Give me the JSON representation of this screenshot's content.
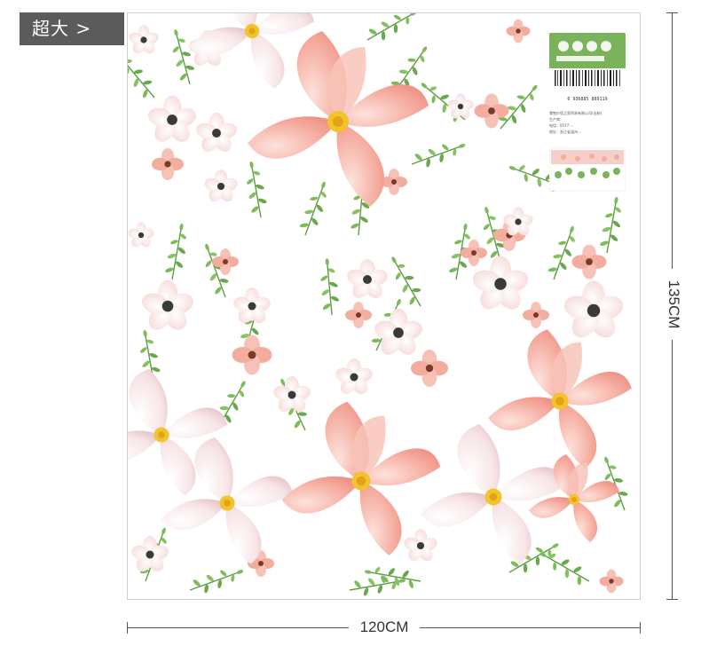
{
  "size_tag": {
    "label": "超大 >"
  },
  "dimensions": {
    "width_label": "120CM",
    "height_label": "135CM"
  },
  "package": {
    "barcode_number": "6 936885 889119",
    "info_lines": [
      "零售价您之家贸易有限公司(出制)",
      "生产商：",
      "电话：0577-...",
      "地址：浙江省温州..."
    ]
  },
  "colors": {
    "tag_bg": "#5b5b5b",
    "petal_pink": "#f3a99a",
    "petal_white": "#f7e8e8",
    "leaf_green": "#6aa84f",
    "flower_center": "#f0c020",
    "dim_line": "#555555"
  }
}
